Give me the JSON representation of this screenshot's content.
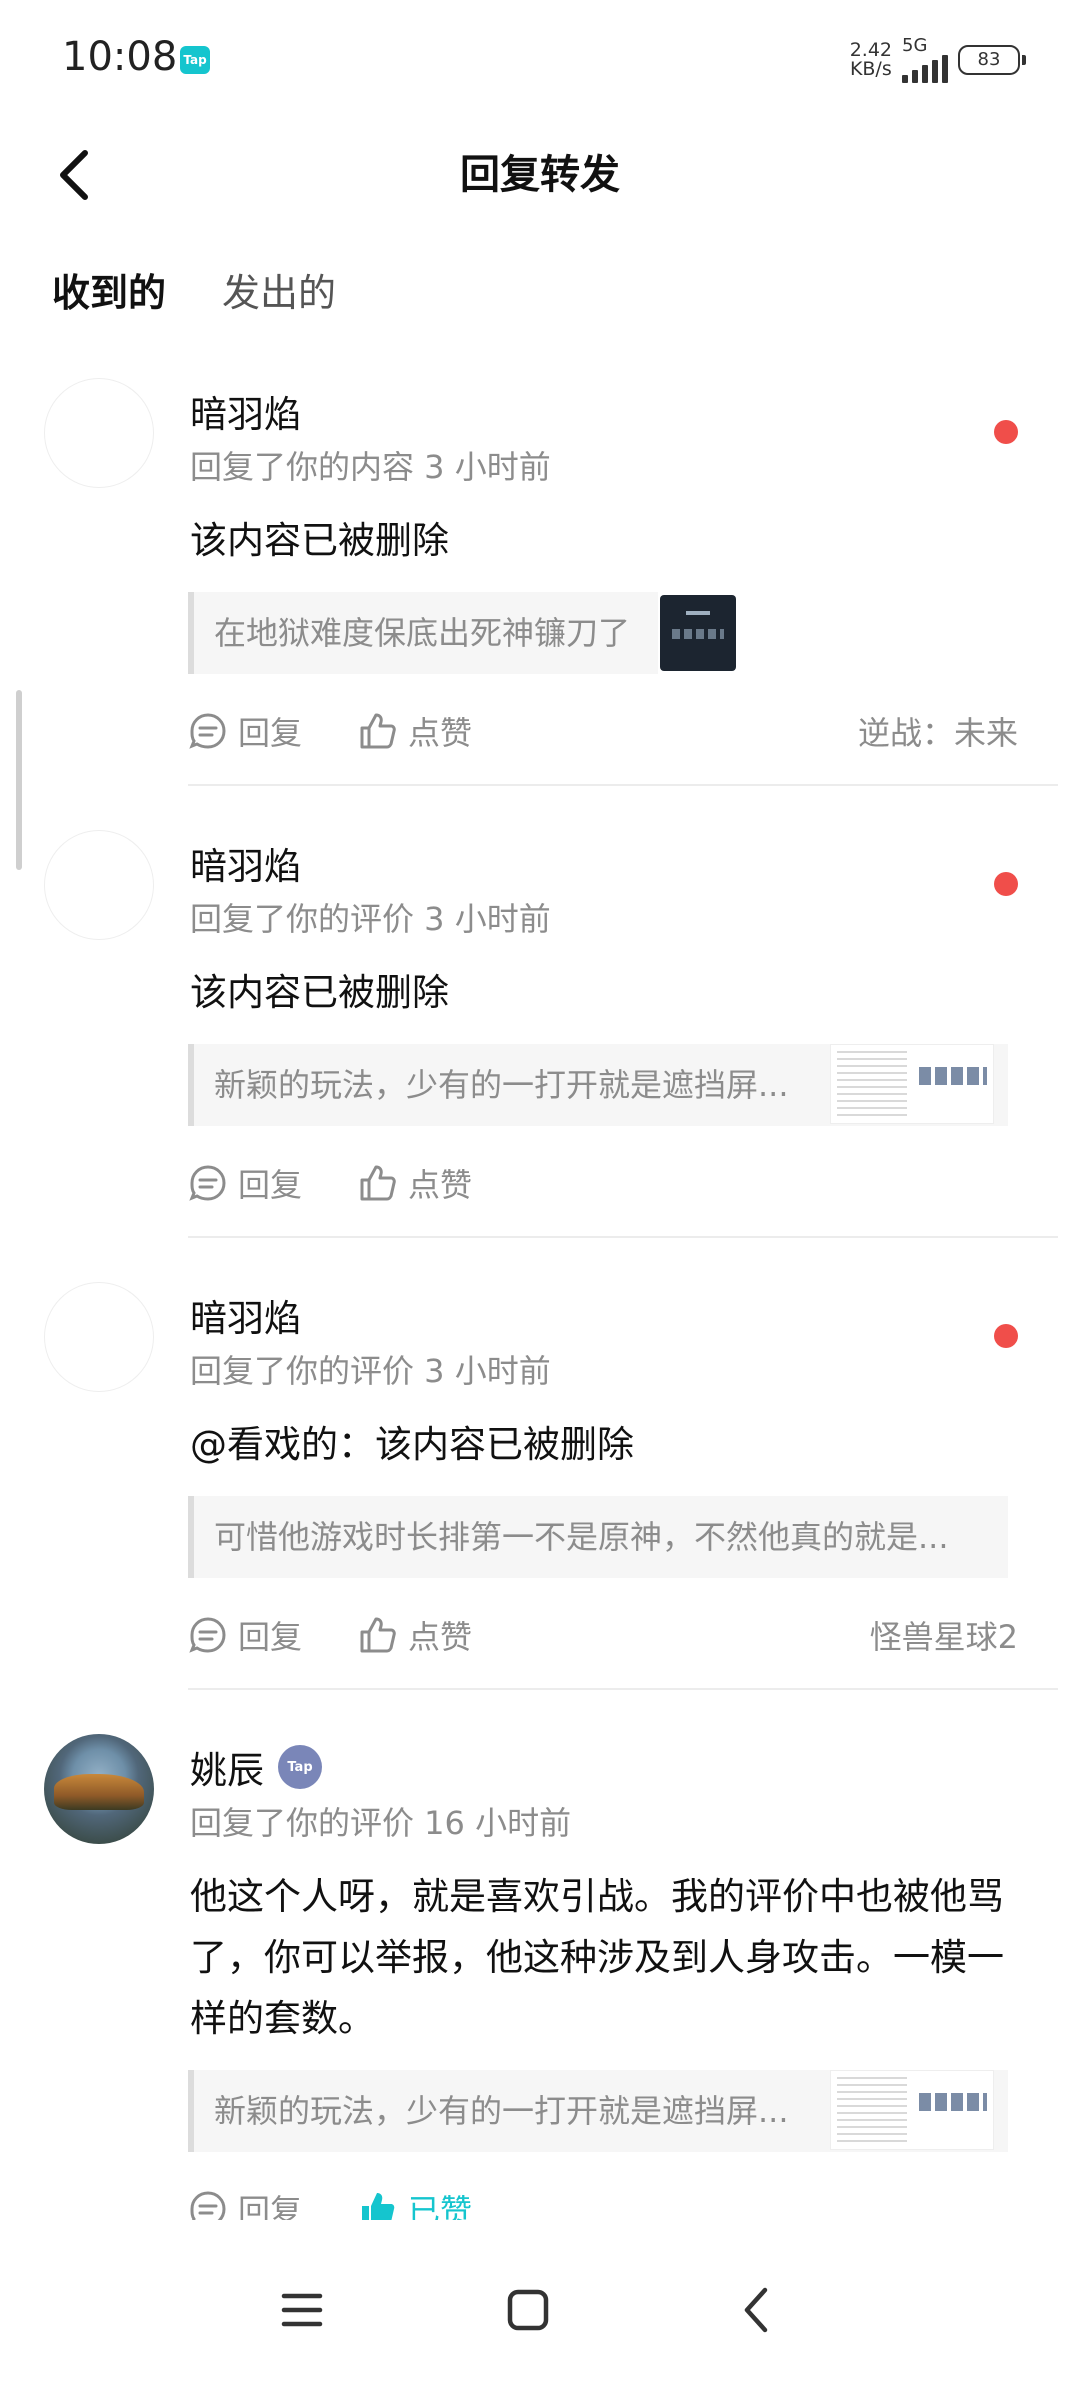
{
  "status_bar": {
    "time": "10:08",
    "app_badge": "Tap",
    "net_speed_value": "2.42",
    "net_speed_unit": "KB/s",
    "network": "5G",
    "battery": "83"
  },
  "header": {
    "title": "回复转发"
  },
  "tabs": [
    {
      "label": "收到的",
      "active": true
    },
    {
      "label": "发出的",
      "active": false
    }
  ],
  "messages": [
    {
      "name": "暗羽焰",
      "meta": "回复了你的内容 3 小时前",
      "body": "该内容已被删除",
      "quote": "在地狱难度保底出死神镰刀了",
      "reply_label": "回复",
      "like_label": "点赞",
      "game": "逆战：未来",
      "unread": true
    },
    {
      "name": "暗羽焰",
      "meta": "回复了你的评价 3 小时前",
      "body": "该内容已被删除",
      "quote": "新颖的玩法，少有的一打开就是遮挡屏...",
      "reply_label": "回复",
      "like_label": "点赞",
      "game": "",
      "unread": true
    },
    {
      "name": "暗羽焰",
      "meta": "回复了你的评价 3 小时前",
      "body": "@看戏的：该内容已被删除",
      "quote": "可惜他游戏时长排第一不是原神，不然他真的就是...",
      "reply_label": "回复",
      "like_label": "点赞",
      "game": "怪兽星球2",
      "unread": true
    },
    {
      "name": "姚辰",
      "badge": "Tap",
      "meta": "回复了你的评价 16 小时前",
      "body": "他这个人呀，就是喜欢引战。我的评价中也被他骂了，你可以举报，他这种涉及到人身攻击。一模一样的套数。",
      "quote": "新颖的玩法，少有的一打开就是遮挡屏...",
      "reply_label": "回复",
      "like_label": "已赞",
      "game": "",
      "unread": false
    }
  ],
  "colors": {
    "accent": "#15c5ce",
    "tab_underline": "#1cd2c0",
    "unread_dot": "#f04e4a",
    "meta_text": "#8c8c8c"
  },
  "icons": {
    "back": "chevron-left-icon",
    "reply": "comment-bubble-icon",
    "like": "thumbs-up-icon",
    "nav_menu": "menu-icon",
    "nav_home": "square-home-icon",
    "nav_back": "chevron-left-icon"
  }
}
